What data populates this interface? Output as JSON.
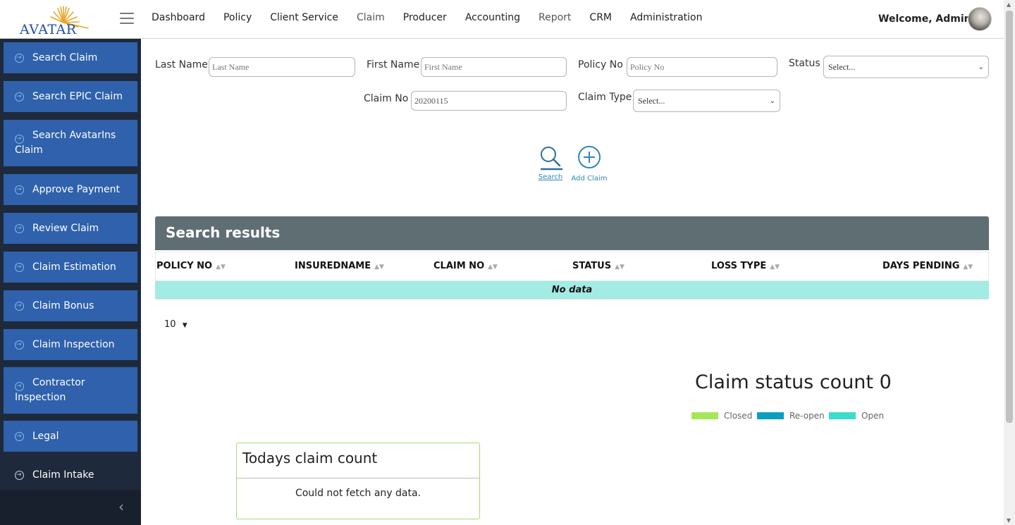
{
  "header": {
    "logo_text": "AVATAR",
    "nav": [
      "Dashboard",
      "Policy",
      "Client Service",
      "Claim",
      "Producer",
      "Accounting",
      "Report",
      "CRM",
      "Administration"
    ],
    "welcome": "Welcome, Admin"
  },
  "sidebar": {
    "items": [
      {
        "label": "Search Claim"
      },
      {
        "label": "Search EPIC Claim"
      },
      {
        "label": "Search AvatarIns Claim"
      },
      {
        "label": "Approve Payment"
      },
      {
        "label": "Review Claim"
      },
      {
        "label": "Claim Estimation"
      },
      {
        "label": "Claim Bonus"
      },
      {
        "label": "Claim Inspection"
      },
      {
        "label": "Contractor Inspection"
      },
      {
        "label": "Legal"
      },
      {
        "label": "Claim Intake"
      }
    ],
    "collapse_icon": "chevron-left-icon"
  },
  "form": {
    "last_name": {
      "label": "Last Name :",
      "placeholder": "Last Name",
      "value": ""
    },
    "first_name": {
      "label": "First Name :",
      "placeholder": "First Name",
      "value": ""
    },
    "policy_no": {
      "label": "Policy No :",
      "placeholder": "Policy No",
      "value": ""
    },
    "status": {
      "label": "Status :",
      "selected": "Select..."
    },
    "claim_no": {
      "label": "Claim No :",
      "placeholder": "",
      "value": "20200115"
    },
    "claim_type": {
      "label": "Claim Type :",
      "selected": "Select..."
    }
  },
  "actions": {
    "search_label": "Search",
    "add_claim_label": "Add Claim"
  },
  "results": {
    "title": "Search results",
    "columns": [
      "POLICY NO",
      "INSUREDNAME",
      "CLAIM NO",
      "STATUS",
      "LOSS TYPE",
      "DAYS PENDING"
    ],
    "empty_text": "No data",
    "page_size": "10"
  },
  "status_chart": {
    "title": "Claim status count 0",
    "legend": [
      {
        "label": "Closed",
        "color": "#a6e75a"
      },
      {
        "label": "Re-open",
        "color": "#0b9fbf"
      },
      {
        "label": "Open",
        "color": "#3bdccb"
      }
    ]
  },
  "todays_card": {
    "title": "Todays claim count",
    "message": "Could not fetch any data."
  },
  "chart_data": {
    "type": "bar",
    "title": "Claim status count 0",
    "series": [
      {
        "name": "Closed",
        "values": []
      },
      {
        "name": "Re-open",
        "values": []
      },
      {
        "name": "Open",
        "values": []
      }
    ]
  }
}
